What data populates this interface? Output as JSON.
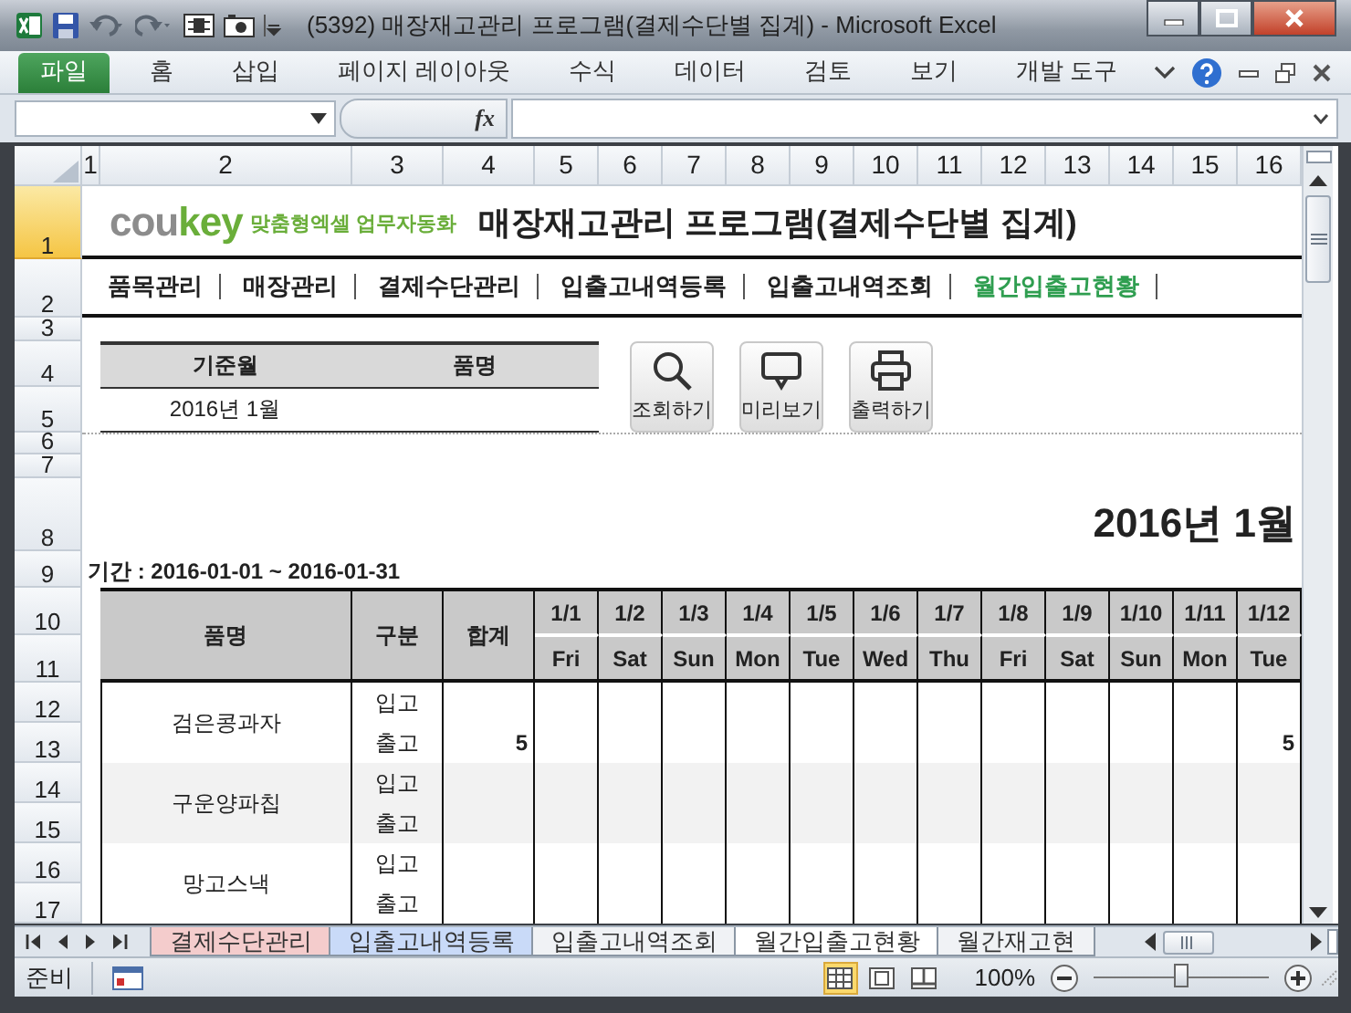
{
  "window": {
    "title": "(5392) 매장재고관리 프로그램(결제수단별 집계) - Microsoft Excel"
  },
  "ribbon_tabs": [
    {
      "label": "파일",
      "kind": "file"
    },
    {
      "label": "홈",
      "kind": "tab"
    },
    {
      "label": "삽입",
      "kind": "tab"
    },
    {
      "label": "페이지 레이아웃",
      "kind": "tab"
    },
    {
      "label": "수식",
      "kind": "tab"
    },
    {
      "label": "데이터",
      "kind": "tab"
    },
    {
      "label": "검토",
      "kind": "tab"
    },
    {
      "label": "보기",
      "kind": "tab"
    },
    {
      "label": "개발 도구",
      "kind": "tab"
    }
  ],
  "formula_bar": {
    "function_label": "fx"
  },
  "column_headers": [
    "1",
    "2",
    "3",
    "4",
    "5",
    "6",
    "7",
    "8",
    "9",
    "10",
    "11",
    "12",
    "13",
    "14",
    "15",
    "16"
  ],
  "row_headers": [
    {
      "label": "1",
      "selected": true
    },
    {
      "label": "2",
      "selected": false
    },
    {
      "label": "3",
      "selected": false
    },
    {
      "label": "4",
      "selected": false
    },
    {
      "label": "5",
      "selected": false
    },
    {
      "label": "6",
      "selected": false
    },
    {
      "label": "7",
      "selected": false
    },
    {
      "label": "8",
      "selected": false
    },
    {
      "label": "9",
      "selected": false
    },
    {
      "label": "10",
      "selected": false
    },
    {
      "label": "11",
      "selected": false
    },
    {
      "label": "12",
      "selected": false
    },
    {
      "label": "13",
      "selected": false
    },
    {
      "label": "14",
      "selected": false
    },
    {
      "label": "15",
      "selected": false
    },
    {
      "label": "16",
      "selected": false
    },
    {
      "label": "17",
      "selected": false
    }
  ],
  "sheet": {
    "logo": [
      {
        "text": "cou",
        "color": "#8c8c8c"
      },
      {
        "text": "key",
        "color": "#6aae3a"
      }
    ],
    "tagline": "맞춤형엑셀 업무자동화",
    "title": "매장재고관리 프로그램(결제수단별 집계)",
    "nav": [
      {
        "label": "품목관리",
        "selected": false
      },
      {
        "label": "매장관리",
        "selected": false
      },
      {
        "label": "결제수단관리",
        "selected": false
      },
      {
        "label": "입출고내역등록",
        "selected": false
      },
      {
        "label": "입출고내역조회",
        "selected": false
      },
      {
        "label": "월간입출고현황",
        "selected": true
      }
    ],
    "filter": {
      "columns": [
        "기준월",
        "품명"
      ],
      "month": "2016년 1월"
    },
    "buttons": [
      {
        "label": "조회하기",
        "kind": "search"
      },
      {
        "label": "미리보기",
        "kind": "preview"
      },
      {
        "label": "출력하기",
        "kind": "print"
      }
    ],
    "month_heading": "2016년 1월",
    "period": "기간 : 2016-01-01 ~ 2016-01-31",
    "table": {
      "columns": [
        "품명",
        "구분",
        "합계"
      ],
      "days": [
        {
          "date": "1/1",
          "weekday": "Fri"
        },
        {
          "date": "1/2",
          "weekday": "Sat"
        },
        {
          "date": "1/3",
          "weekday": "Sun"
        },
        {
          "date": "1/4",
          "weekday": "Mon"
        },
        {
          "date": "1/5",
          "weekday": "Tue"
        },
        {
          "date": "1/6",
          "weekday": "Wed"
        },
        {
          "date": "1/7",
          "weekday": "Thu"
        },
        {
          "date": "1/8",
          "weekday": "Fri"
        },
        {
          "date": "1/9",
          "weekday": "Sat"
        },
        {
          "date": "1/10",
          "weekday": "Sun"
        },
        {
          "date": "1/11",
          "weekday": "Mon"
        },
        {
          "date": "1/12",
          "weekday": "Tue"
        }
      ],
      "rows": [
        {
          "name": "검은콩과자",
          "lines": [
            {
              "type": "입고"
            },
            {
              "type": "출고",
              "total": "5",
              "cells": [
                {
                  "kind": "blank"
                },
                {
                  "kind": "blank"
                },
                {
                  "kind": "blank"
                },
                {
                  "kind": "blank"
                },
                {
                  "kind": "blank"
                },
                {
                  "kind": "blank"
                },
                {
                  "kind": "blank"
                },
                {
                  "kind": "blank"
                },
                {
                  "kind": "blank"
                },
                {
                  "kind": "blank"
                },
                {
                  "kind": "blank"
                },
                {
                  "kind": "number",
                  "value": "5"
                }
              ]
            }
          ]
        },
        {
          "name": "구운양파칩",
          "lines": [
            {
              "type": "입고"
            },
            {
              "type": "출고"
            }
          ]
        },
        {
          "name": "망고스낵",
          "lines": [
            {
              "type": "입고"
            },
            {
              "type": "출고"
            }
          ]
        }
      ]
    }
  },
  "sheet_tabs": [
    {
      "label": "결제수단관리",
      "selected": false,
      "color": "#f4cccc"
    },
    {
      "label": "입출고내역등록",
      "selected": false,
      "color": "#c9daf8"
    },
    {
      "label": "입출고내역조회",
      "selected": false
    },
    {
      "label": "월간입출고현황",
      "selected": true
    },
    {
      "label": "월간재고현",
      "selected": false
    }
  ],
  "status_bar": {
    "mode": "준비",
    "views": [
      {
        "kind": "normal",
        "selected": true
      },
      {
        "kind": "layout",
        "selected": false
      },
      {
        "kind": "break",
        "selected": false
      }
    ],
    "zoom": "100%",
    "zoom_slider": {
      "level": 0.5
    }
  }
}
